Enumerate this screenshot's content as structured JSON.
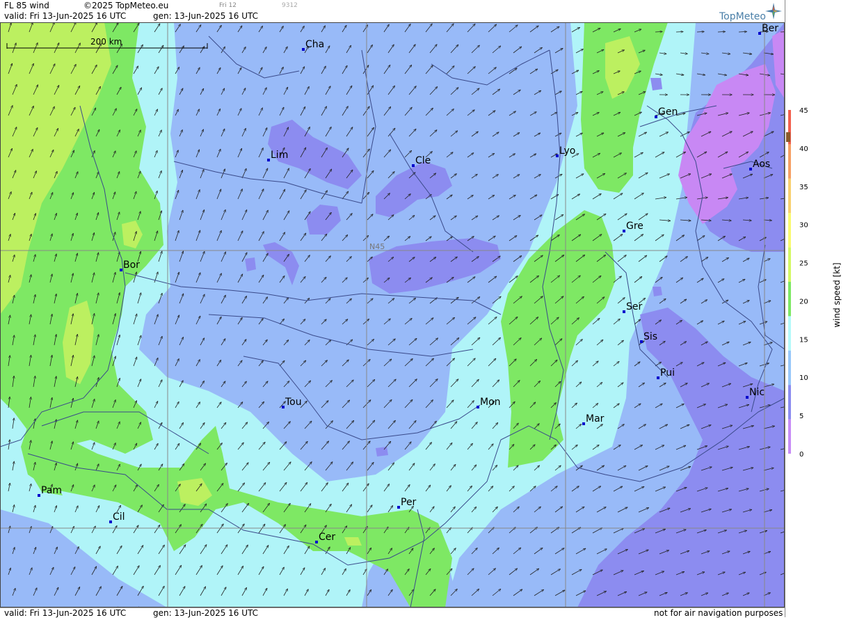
{
  "header": {
    "product": "FL 85 wind",
    "copyright": "©2025 TopMeteo.eu",
    "tab_small": "Fri 12",
    "code_small": "9312",
    "valid_line": "valid:  Fri  13-Jun-2025  16 UTC",
    "gen_line": "gen: 13-Jun-2025  16 UTC",
    "logo_text": "TopMeteo"
  },
  "footer": {
    "valid_line": "valid:  Fri  13-Jun-2025  16 UTC",
    "gen_line": "gen: 13-Jun-2025  16 UTC",
    "disclaimer": "not for air navigation purposes"
  },
  "map": {
    "scale_label": "200 km",
    "gridline_label": "N45",
    "cities": [
      {
        "id": "cha",
        "label": "Cha"
      },
      {
        "id": "ber",
        "label": "Ber"
      },
      {
        "id": "gen",
        "label": "Gen"
      },
      {
        "id": "lim",
        "label": "Lim"
      },
      {
        "id": "cle",
        "label": "Cle"
      },
      {
        "id": "lyo",
        "label": "Lyo"
      },
      {
        "id": "aos",
        "label": "Aos"
      },
      {
        "id": "gre",
        "label": "Gre"
      },
      {
        "id": "bor",
        "label": "Bor"
      },
      {
        "id": "ser",
        "label": "Ser"
      },
      {
        "id": "sis",
        "label": "Sis"
      },
      {
        "id": "pui",
        "label": "Pui"
      },
      {
        "id": "nic",
        "label": "Nic"
      },
      {
        "id": "tou",
        "label": "Tou"
      },
      {
        "id": "mon",
        "label": "Mon"
      },
      {
        "id": "mar",
        "label": "Mar"
      },
      {
        "id": "pam",
        "label": "Pam"
      },
      {
        "id": "per",
        "label": "Per"
      },
      {
        "id": "cil",
        "label": "Cil"
      },
      {
        "id": "cer",
        "label": "Cer"
      }
    ]
  },
  "legend": {
    "title": "wind  speed  [kt]",
    "ticks": [
      "45",
      "40",
      "35",
      "30",
      "25",
      "20",
      "15",
      "10",
      "5",
      "0"
    ],
    "colors": [
      "#f2604e",
      "#f6a064",
      "#f8d070",
      "#fafa70",
      "#d4f864",
      "#7ee864",
      "#b4fafa",
      "#98c8fa",
      "#8c8cf0",
      "#c88cf6"
    ]
  },
  "palette": {
    "c0_5": "#c888f4",
    "c5_10": "#8c8cf0",
    "c10_15": "#98baf8",
    "c15_20": "#b0f4f8",
    "c20_25": "#7ee864",
    "c25_30": "#bcf060"
  }
}
